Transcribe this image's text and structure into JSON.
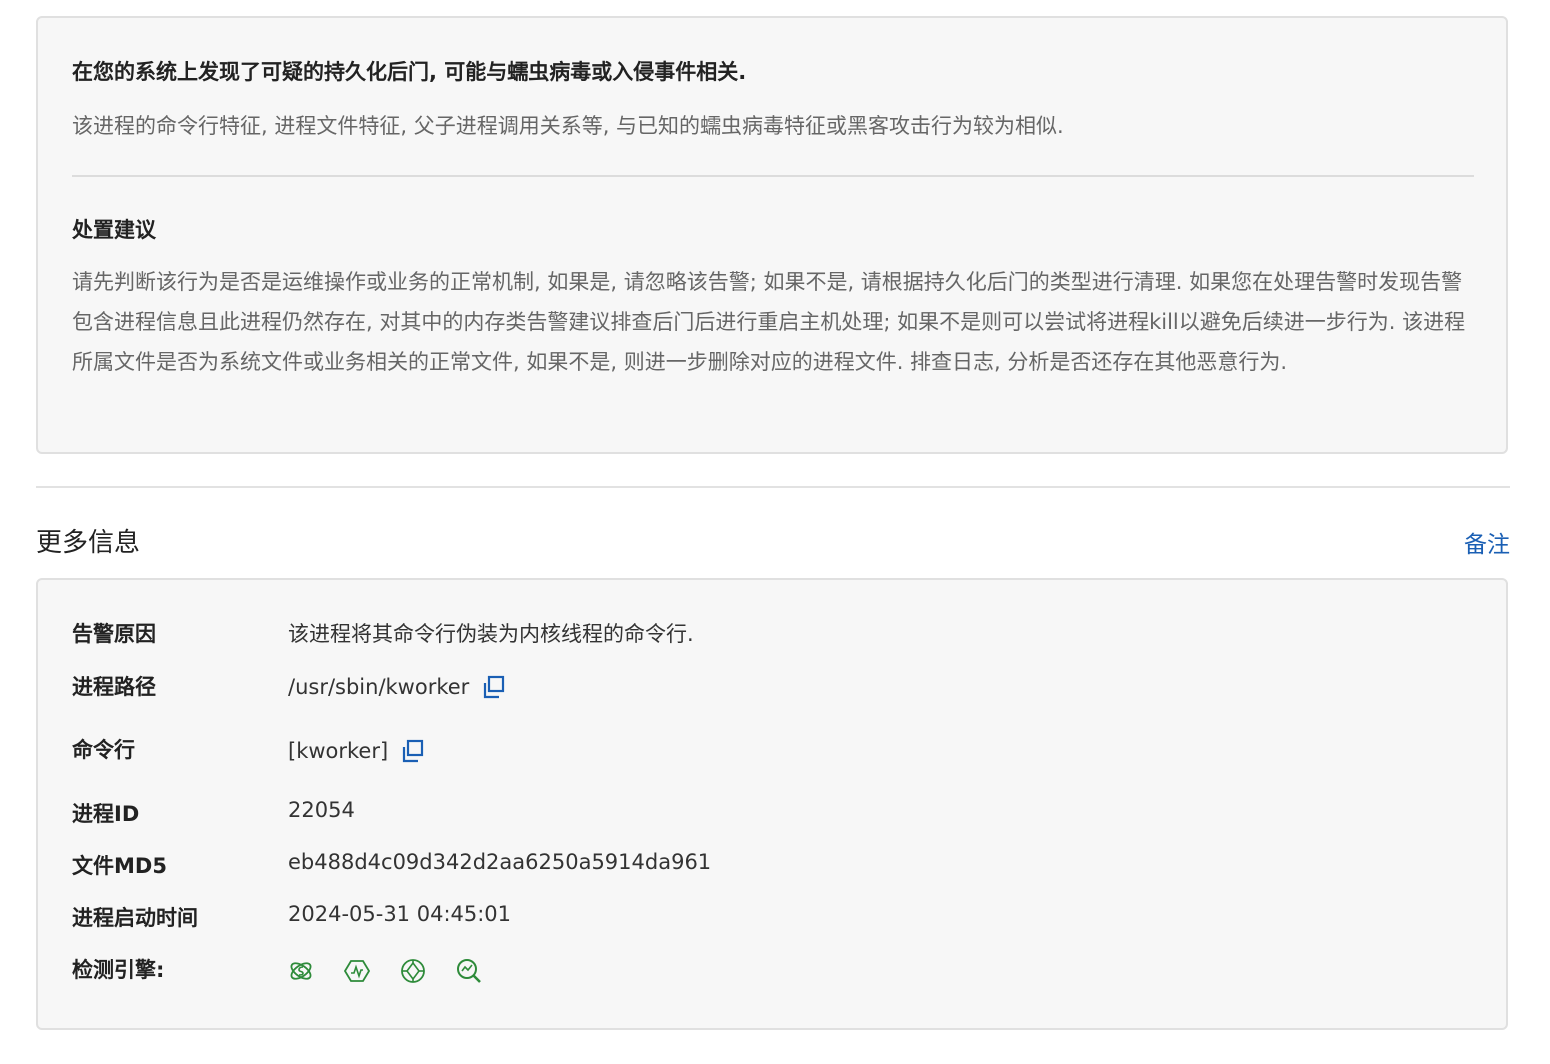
{
  "alert": {
    "headline": "在您的系统上发现了可疑的持久化后门, 可能与蠕虫病毒或入侵事件相关.",
    "description": "该进程的命令行特征, 进程文件特征, 父子进程调用关系等, 与已知的蠕虫病毒特征或黑客攻击行为较为相似.",
    "suggestion_title": "处置建议",
    "suggestion_body": "请先判断该行为是否是运维操作或业务的正常机制, 如果是, 请忽略该告警; 如果不是, 请根据持久化后门的类型进行清理. 如果您在处理告警时发现告警包含进程信息且此进程仍然存在, 对其中的内存类告警建议排查后门后进行重启主机处理; 如果不是则可以尝试将进程kill以避免后续进一步行为. 该进程所属文件是否为系统文件或业务相关的正常文件, 如果不是, 则进一步删除对应的进程文件. 排查日志, 分析是否还存在其他恶意行为."
  },
  "more_info": {
    "title": "更多信息",
    "note_label": "备注",
    "rows": [
      {
        "label": "告警原因",
        "value": "该进程将其命令行伪装为内核线程的命令行."
      },
      {
        "label": "进程路径",
        "value": "/usr/sbin/kworker"
      },
      {
        "label": "命令行",
        "value": "[kworker]"
      },
      {
        "label": "进程ID",
        "value": "22054"
      },
      {
        "label": "文件MD5",
        "value": "eb488d4c09d342d2aa6250a5914da961"
      },
      {
        "label": "进程启动时间",
        "value": "2024-05-31 04:45:01"
      },
      {
        "label": "检测引擎:",
        "value": ""
      }
    ],
    "engine_icons": [
      "engine-ai-icon",
      "engine-behavior-icon",
      "engine-target-icon",
      "engine-scan-icon"
    ]
  },
  "colors": {
    "link": "#1a5fb4",
    "copy_icon": "#1a5fb4",
    "engine_icon": "#2e8b3a"
  }
}
